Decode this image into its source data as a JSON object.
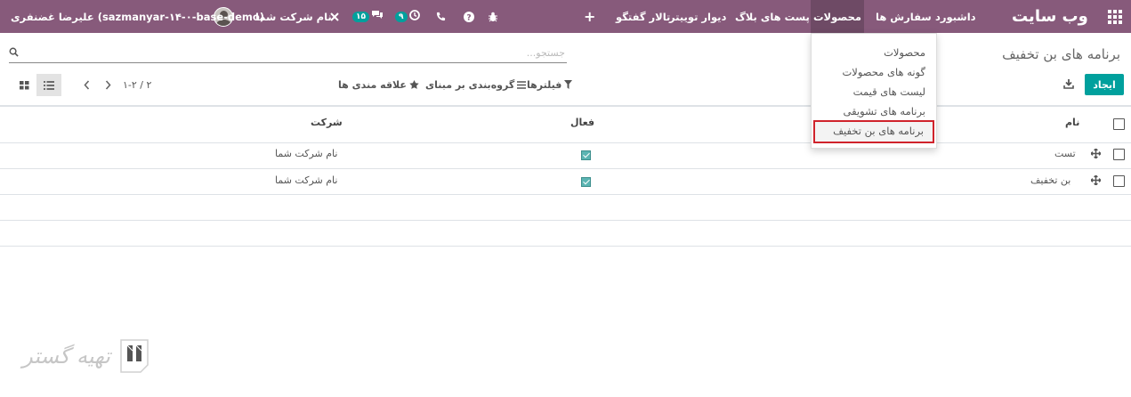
{
  "navbar": {
    "brand": "وب سایت",
    "menu": [
      "داشبورد",
      "سفارش ها",
      "محصولات",
      "پست های بلاگ",
      "دیوار توییتر",
      "تالار گفتگو"
    ],
    "active_menu": "محصولات",
    "plus_label": "+",
    "activity_badge": "۹",
    "messages_badge": "۱۵",
    "company_switcher": "نام شرکت شما",
    "user_name": "علیرضا غضنفری (sazmanyar-۱۴-۰-base-demo)"
  },
  "dropdown": {
    "items": [
      "محصولات",
      "گونه های محصولات",
      "لیست های قیمت",
      "برنامه های تشویقی",
      "برنامه های بن تخفیف"
    ],
    "selected": "برنامه های بن تخفیف"
  },
  "control_panel": {
    "title": "برنامه های بن تخفیف",
    "search_placeholder": "جستجو...",
    "create_label": "ایجاد",
    "filters_label": "فیلترها",
    "groupby_label": "گروه‌بندی بر مبنای",
    "favorites_label": "علاقه مندی ها",
    "pager": "۱-۲ / ۲"
  },
  "table": {
    "columns": [
      "نام",
      "فعال",
      "شرکت"
    ],
    "rows": [
      {
        "name": "تست",
        "active": true,
        "company": "نام شرکت شما"
      },
      {
        "name": "بن تخفیف",
        "active": true,
        "company": "نام شرکت شما"
      }
    ]
  },
  "watermark": {
    "text": "تهیه گستر"
  },
  "colors": {
    "navbar": "#875a7b",
    "primary": "#00a09d",
    "highlight_border": "#d0232c"
  }
}
